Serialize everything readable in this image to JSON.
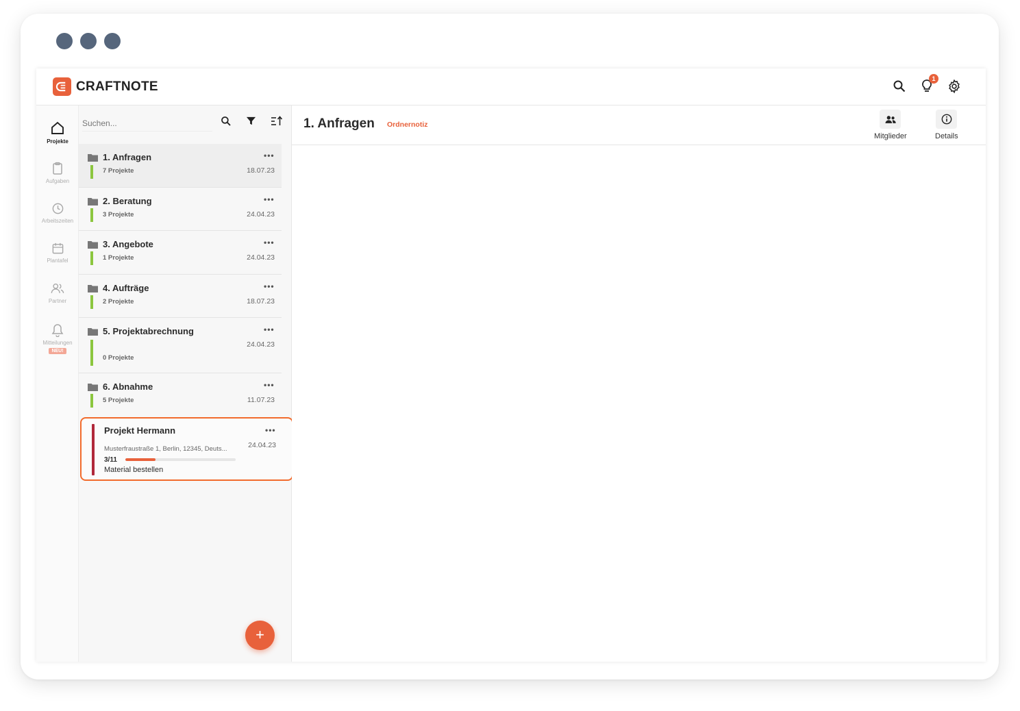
{
  "app": {
    "brand": "CRAFTNOTE",
    "accent_color": "#e8613b"
  },
  "topbar": {
    "icons": [
      "search-icon",
      "lightbulb-icon",
      "gear-icon"
    ],
    "notification_count": "1"
  },
  "rail": {
    "items": [
      {
        "label": "Projekte",
        "icon": "home-icon",
        "active": true
      },
      {
        "label": "Aufgaben",
        "icon": "clipboard-icon"
      },
      {
        "label": "Arbeitszeiten",
        "icon": "clock-icon"
      },
      {
        "label": "Plantafel",
        "icon": "calendar-icon"
      },
      {
        "label": "Partner",
        "icon": "users-icon"
      },
      {
        "label": "Mitteilungen",
        "icon": "bell-icon",
        "badge": "NEU!"
      }
    ]
  },
  "list": {
    "search_placeholder": "Suchen...",
    "tools": [
      "search-icon",
      "filter-icon",
      "sort-icon"
    ],
    "more_label": "•••",
    "folders": [
      {
        "name": "1. Anfragen",
        "count": "7 Projekte",
        "date": "18.07.23",
        "selected": true
      },
      {
        "name": "2. Beratung",
        "count": "3 Projekte",
        "date": "24.04.23"
      },
      {
        "name": "3. Angebote",
        "count": "1 Projekte",
        "date": "24.04.23"
      },
      {
        "name": "4. Aufträge",
        "count": "2 Projekte",
        "date": "18.07.23"
      },
      {
        "name": "5. Projektabrechnung",
        "count": "0 Projekte",
        "date": "24.04.23"
      },
      {
        "name": "6. Abnahme",
        "count": "5 Projekte",
        "date": "11.07.23"
      }
    ],
    "project": {
      "name": "Projekt Hermann",
      "date": "24.04.23",
      "address": "Musterfraustraße 1, Berlin, 12345, Deuts...",
      "progress_label": "3/11",
      "progress_done": 3,
      "progress_total": 11,
      "task": "Material bestellen",
      "status_color": "#b0283a"
    },
    "fab_label": "+"
  },
  "content": {
    "title": "1. Anfragen",
    "note_link": "Ordnernotiz",
    "actions": [
      {
        "label": "Mitglieder",
        "icon": "members-icon"
      },
      {
        "label": "Details",
        "icon": "info-icon"
      }
    ]
  }
}
